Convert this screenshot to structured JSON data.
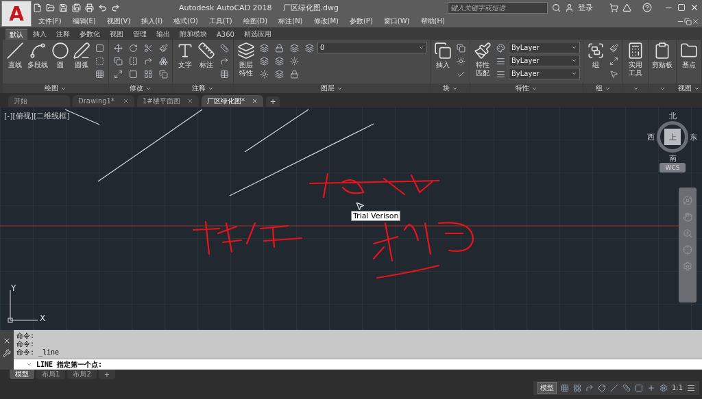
{
  "app_button": {
    "label": "A"
  },
  "title_bar": {
    "title": "Autodesk AutoCAD 2018",
    "file": "厂区绿化图.dwg",
    "search": {
      "placeholder": "键入关键字或短语"
    },
    "login": "登录"
  },
  "menu": [
    "文件(F)",
    "编辑(E)",
    "视图(V)",
    "插入(I)",
    "格式(O)",
    "工具(T)",
    "绘图(D)",
    "标注(N)",
    "修改(M)",
    "参数(P)",
    "窗口(W)",
    "帮助(H)"
  ],
  "ribbon_tabs": [
    {
      "label": "默认",
      "selected": true
    },
    {
      "label": "插入",
      "selected": false
    },
    {
      "label": "注释",
      "selected": false
    },
    {
      "label": "参数化",
      "selected": false
    },
    {
      "label": "视图",
      "selected": false
    },
    {
      "label": "管理",
      "selected": false
    },
    {
      "label": "输出",
      "selected": false
    },
    {
      "label": "附加模块",
      "selected": false
    },
    {
      "label": "A360",
      "selected": false
    },
    {
      "label": "精选应用",
      "selected": false
    }
  ],
  "ribbon_panels": [
    {
      "title": "绘图",
      "tools": [
        {
          "kind": "large",
          "label": "直线"
        },
        {
          "kind": "large",
          "label": "多段线"
        },
        {
          "kind": "large",
          "label": "圆"
        },
        {
          "kind": "large",
          "label": "圆弧"
        },
        {
          "kind": "small"
        },
        {
          "kind": "small"
        },
        {
          "kind": "small"
        }
      ]
    },
    {
      "title": "修改",
      "tools": [
        {
          "kind": "small"
        },
        {
          "kind": "small"
        },
        {
          "kind": "small"
        },
        {
          "kind": "small"
        },
        {
          "kind": "small"
        },
        {
          "kind": "small"
        },
        {
          "kind": "small"
        },
        {
          "kind": "small"
        },
        {
          "kind": "small"
        },
        {
          "kind": "small"
        },
        {
          "kind": "small"
        },
        {
          "kind": "small"
        }
      ]
    },
    {
      "title": "注释",
      "tools": [
        {
          "kind": "large",
          "label": "文字"
        },
        {
          "kind": "large",
          "label": "标注"
        },
        {
          "kind": "small"
        },
        {
          "kind": "small"
        },
        {
          "kind": "small"
        }
      ]
    },
    {
      "title": "图层",
      "tools": [
        {
          "kind": "large",
          "label": "图层特性"
        },
        {
          "kind": "dropdown",
          "value": "0"
        },
        {
          "kind": "small"
        },
        {
          "kind": "small"
        },
        {
          "kind": "small"
        },
        {
          "kind": "small"
        },
        {
          "kind": "small"
        },
        {
          "kind": "small"
        },
        {
          "kind": "small"
        },
        {
          "kind": "small"
        },
        {
          "kind": "small"
        },
        {
          "kind": "small"
        }
      ]
    },
    {
      "title": "块",
      "tools": [
        {
          "kind": "large",
          "label": "插入"
        },
        {
          "kind": "small"
        },
        {
          "kind": "small"
        },
        {
          "kind": "small"
        }
      ]
    },
    {
      "title": "特性",
      "tools": [
        {
          "kind": "large",
          "label": "特性匹配"
        },
        {
          "kind": "small"
        },
        {
          "kind": "small"
        },
        {
          "kind": "small"
        },
        {
          "kind": "dropdown",
          "value": "ByLayer"
        },
        {
          "kind": "dropdown",
          "value": "ByLayer"
        },
        {
          "kind": "dropdown",
          "value": "ByLayer"
        }
      ]
    },
    {
      "title": "组",
      "tools": [
        {
          "kind": "large",
          "label": "组"
        },
        {
          "kind": "small"
        },
        {
          "kind": "small"
        },
        {
          "kind": "small"
        }
      ]
    },
    {
      "tools": [
        {
          "kind": "large",
          "label": "实用工具"
        }
      ]
    },
    {
      "tools": [
        {
          "kind": "large",
          "label": "剪贴板"
        }
      ]
    },
    {
      "title": "视图",
      "tools": [
        {
          "kind": "large",
          "label": "基点"
        }
      ]
    }
  ],
  "file_tabs": [
    {
      "label": "开始",
      "selected": false,
      "closable": false
    },
    {
      "label": "Drawing1*",
      "selected": false,
      "closable": true
    },
    {
      "label": "1#楼平面图",
      "selected": false,
      "closable": true
    },
    {
      "label": "厂区绿化图*",
      "selected": true,
      "closable": true
    }
  ],
  "add_tab": "+",
  "viewport": {
    "label": "[-][俯视][二维线框]",
    "tooltip": "Trial Verison",
    "viewcube": {
      "top": "北",
      "right": "东",
      "bottom": "南",
      "left": "西",
      "face": "上"
    },
    "ucs_button": "WCS",
    "ucs": {
      "x": "X",
      "y": "Y"
    }
  },
  "command": {
    "history": [
      "命令:",
      "命令:",
      "命令: _line"
    ],
    "prompt": "LINE 指定第一个点:"
  },
  "layout_tabs": [
    {
      "label": "模型",
      "selected": true
    },
    {
      "label": "布局1",
      "selected": false
    },
    {
      "label": "布局2",
      "selected": false
    }
  ],
  "layout_add": "+",
  "status_bar": {
    "space": "模型",
    "scale": "1:1"
  }
}
